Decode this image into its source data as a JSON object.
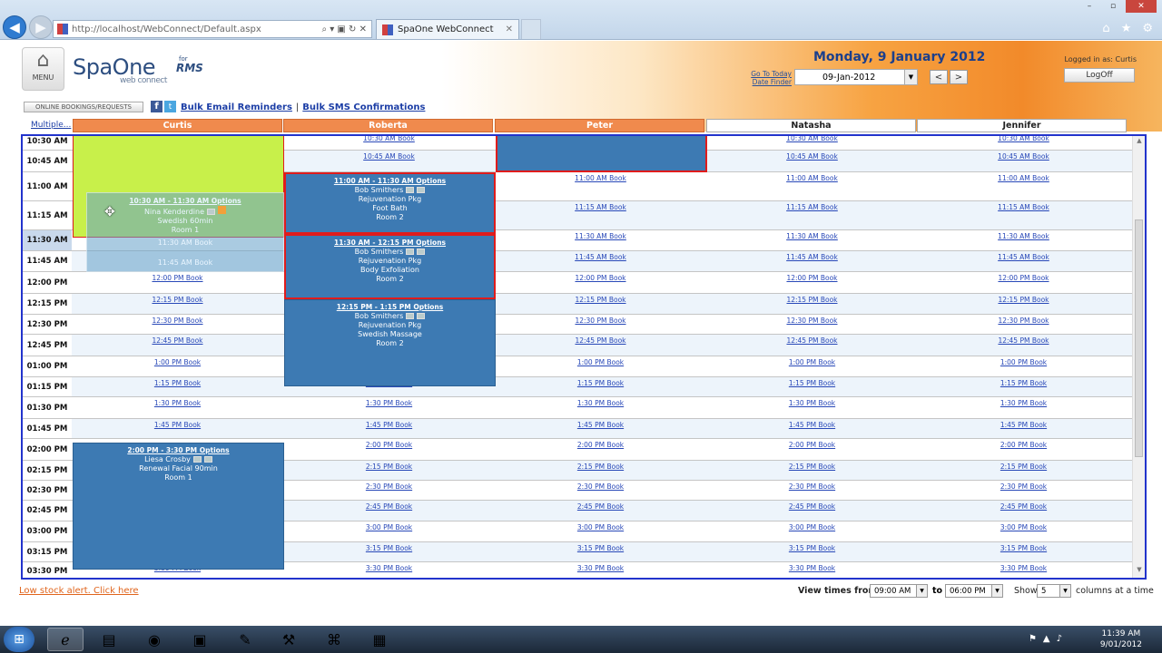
{
  "browser": {
    "url": "http://localhost/WebConnect/Default.aspx",
    "tab_title": "SpaOne WebConnect",
    "address_controls": "⌕ ▾ ▣ ↻ ✕",
    "window_controls": [
      "–",
      "▫",
      "✕"
    ],
    "toolbar_icons": [
      "home-icon",
      "star-icon",
      "gear-icon"
    ]
  },
  "header": {
    "menu_label": "MENU",
    "logo_text": "SpaOne",
    "logo_sub": "web connect",
    "rms_for": "for",
    "rms_text": "RMS",
    "date_title": "Monday, 9 January 2012",
    "goto_today": "Go To Today",
    "date_finder": "Date Finder",
    "date_value": "09-Jan-2012",
    "prev": "<",
    "next": ">",
    "logged_in": "Logged in as: Curtis",
    "logoff": "LogOff",
    "online_bookings": "ONLINE BOOKINGS/REQUESTS",
    "bulk_email": "Bulk Email Reminders",
    "bulk_sep": "|",
    "bulk_sms": "Bulk SMS Confirmations",
    "multiple": "Multiple..."
  },
  "staff": [
    {
      "name": "Curtis",
      "style": "o"
    },
    {
      "name": "Roberta",
      "style": "o"
    },
    {
      "name": "Peter",
      "style": "o"
    },
    {
      "name": "Natasha",
      "style": "w"
    },
    {
      "name": "Jennifer",
      "style": "w"
    }
  ],
  "times": [
    {
      "label": "10:30 AM",
      "book": "10:30 AM Book"
    },
    {
      "label": "10:45 AM",
      "book": "10:45 AM Book"
    },
    {
      "label": "11:00 AM",
      "book": "11:00 AM Book"
    },
    {
      "label": "11:15 AM",
      "book": "11:15 AM Book"
    },
    {
      "label": "11:30 AM",
      "book": "11:30 AM Book"
    },
    {
      "label": "11:45 AM",
      "book": "11:45 AM Book"
    },
    {
      "label": "12:00 PM",
      "book": "12:00 PM Book"
    },
    {
      "label": "12:15 PM",
      "book": "12:15 PM Book"
    },
    {
      "label": "12:30 PM",
      "book": "12:30 PM Book"
    },
    {
      "label": "12:45 PM",
      "book": "12:45 PM Book"
    },
    {
      "label": "01:00 PM",
      "book": "1:00 PM Book"
    },
    {
      "label": "01:15 PM",
      "book": "1:15 PM Book"
    },
    {
      "label": "01:30 PM",
      "book": "1:30 PM Book"
    },
    {
      "label": "01:45 PM",
      "book": "1:45 PM Book"
    },
    {
      "label": "02:00 PM",
      "book": "2:00 PM Book"
    },
    {
      "label": "02:15 PM",
      "book": "2:15 PM Book"
    },
    {
      "label": "02:30 PM",
      "book": "2:30 PM Book"
    },
    {
      "label": "02:45 PM",
      "book": "2:45 PM Book"
    },
    {
      "label": "03:00 PM",
      "book": "3:00 PM Book"
    },
    {
      "label": "03:15 PM",
      "book": "3:15 PM Book"
    },
    {
      "label": "03:30 PM",
      "book": "3:30 PM Book"
    }
  ],
  "bookings": {
    "roberta_1": {
      "title": "11:00 AM - 11:30 AM Options",
      "client": "Bob Smithers",
      "service": "Rejuvenation Pkg",
      "detail": "Foot Bath",
      "room": "Room 2"
    },
    "roberta_2": {
      "title": "11:30 AM - 12:15 PM Options",
      "client": "Bob Smithers",
      "service": "Rejuvenation Pkg",
      "detail": "Body Exfoliation",
      "room": "Room 2"
    },
    "roberta_3": {
      "title": "12:15 PM - 1:15 PM Options",
      "client": "Bob Smithers",
      "service": "Rejuvenation Pkg",
      "detail": "Swedish Massage",
      "room": "Room 2"
    },
    "curtis_1": {
      "title": "2:00 PM - 3:30 PM Options",
      "client": "Liesa Crosby",
      "service": "Renewal Facial 90min",
      "room": "Room 1"
    },
    "dragged": {
      "title": "10:30 AM - 11:30 AM Options",
      "client": "Nina Kenderdine",
      "service": "Swedish 60min",
      "room": "Room 1",
      "ghost_a": "11:30 AM Book",
      "ghost_b": "11:45 AM Book"
    }
  },
  "footer": {
    "low_stock": "Low stock alert. Click here",
    "view_times": "View times from",
    "from": "09:00 AM",
    "to_label": "to",
    "to": "06:00 PM",
    "show": "Show",
    "columns": "5",
    "at_a_time": "columns at a time"
  },
  "taskbar": {
    "clock_time": "11:39 AM",
    "clock_date": "9/01/2012",
    "apps": [
      "ie-icon",
      "folder-icon",
      "chrome-icon",
      "explorer-icon",
      "paint-icon",
      "tools-icon",
      "network-icon",
      "vs-icon"
    ]
  },
  "colors": {
    "accent_orange": "#f08a4d",
    "booking_blue": "#3d7ab3",
    "selected_lime": "#c8f04a",
    "grid_border": "#2233cc"
  }
}
